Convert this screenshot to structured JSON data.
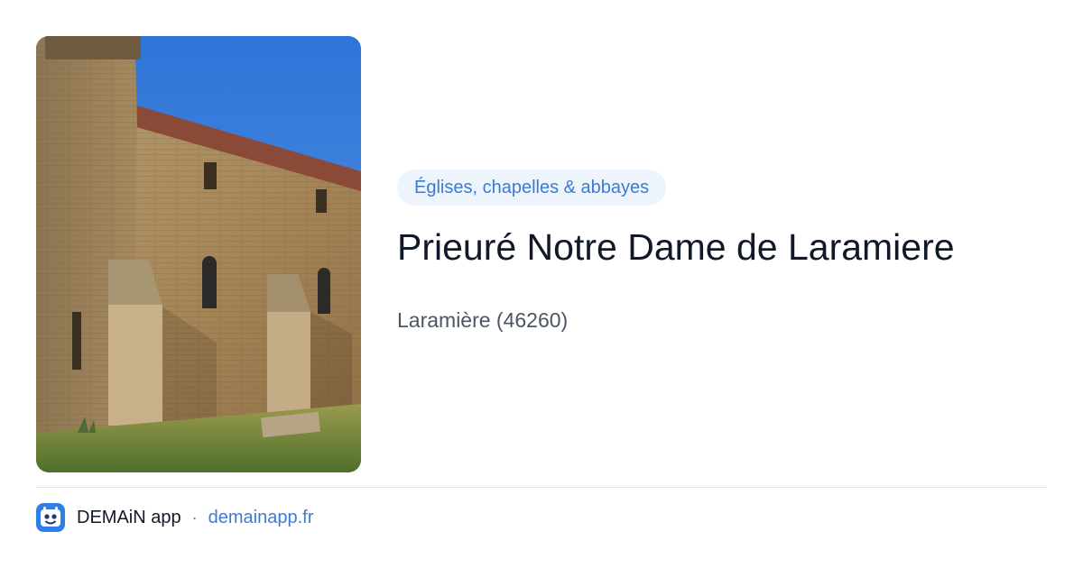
{
  "place": {
    "category": "Églises, chapelles & abbayes",
    "title": "Prieuré Notre Dame de Laramiere",
    "location": "Laramière (46260)"
  },
  "footer": {
    "app_name": "DEMAiN app",
    "separator": "·",
    "url": "demainapp.fr"
  },
  "colors": {
    "accent": "#3a7bd5",
    "chip_background": "#eef4fc",
    "title_text": "#111827",
    "secondary_text": "#4b5563"
  },
  "icons": {
    "app_logo": "demain-app-logo-icon"
  }
}
